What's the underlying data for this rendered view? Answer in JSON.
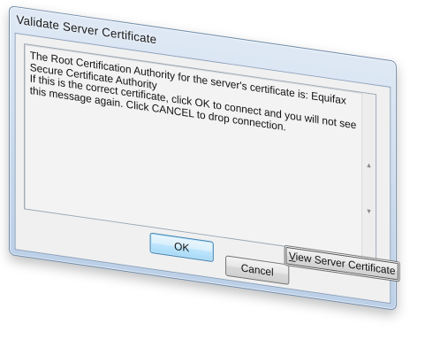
{
  "window": {
    "title": "Validate Server Certificate"
  },
  "message": {
    "text": "The Root Certification Authority for the server's certificate is: Equifax\nSecure Certificate Authority\nIf this is the correct certificate, click OK to connect and you will not see\nthis message again.  Click CANCEL to drop connection."
  },
  "buttons": {
    "ok_label": "OK",
    "cancel_label": "Cancel",
    "view_certificate_label_mnemonic": "V",
    "view_certificate_label_rest": "iew Server Certificate"
  },
  "icons": {
    "scroll_up": "scroll-up-arrow-icon",
    "scroll_down": "scroll-down-arrow-icon"
  },
  "colors": {
    "frame": "#c9d9ec",
    "client": "#f0f0f0",
    "default_button": "#bee6fd"
  }
}
